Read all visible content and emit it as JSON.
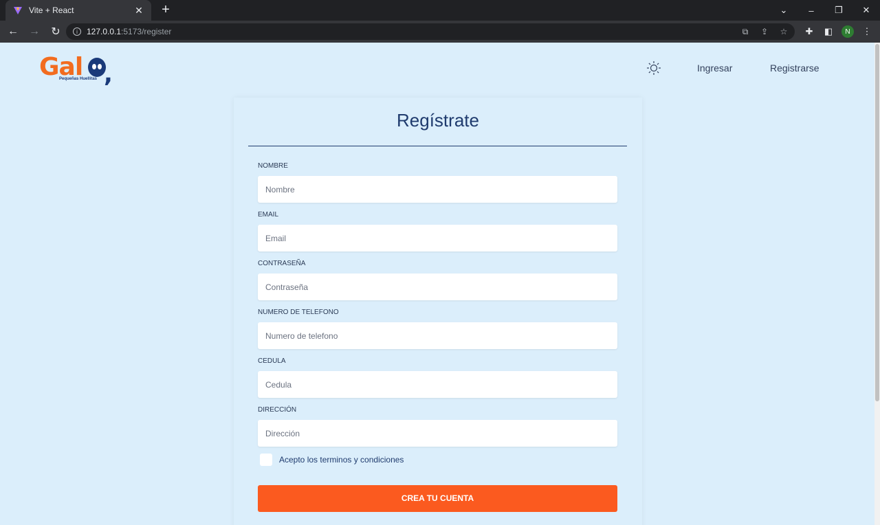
{
  "browser": {
    "tab_title": "Vite + React",
    "url_host": "127.0.0.1",
    "url_path": ":5173/register",
    "profile_initial": "N"
  },
  "header": {
    "logo_text": "Gal",
    "logo_sub": "Pequeñas Huellitas",
    "nav": [
      {
        "label": "Ingresar"
      },
      {
        "label": "Registrarse"
      }
    ]
  },
  "form": {
    "title": "Regístrate",
    "fields": [
      {
        "label": "NOMBRE",
        "placeholder": "Nombre"
      },
      {
        "label": "EMAIL",
        "placeholder": "Email"
      },
      {
        "label": "CONTRASEÑA",
        "placeholder": "Contraseña"
      },
      {
        "label": "NUMERO DE TELEFONO",
        "placeholder": "Numero de telefono"
      },
      {
        "label": "CEDULA",
        "placeholder": "Cedula"
      },
      {
        "label": "DIRECCIÓN",
        "placeholder": "Dirección"
      }
    ],
    "terms_label": "Acepto los terminos y condiciones",
    "terms_checked": false,
    "submit_label": "CREA TU CUENTA"
  },
  "colors": {
    "brand_orange": "#f26c1f",
    "brand_navy": "#1a3a7a",
    "button": "#fb5a1f",
    "page_bg": "#dbeefb"
  }
}
